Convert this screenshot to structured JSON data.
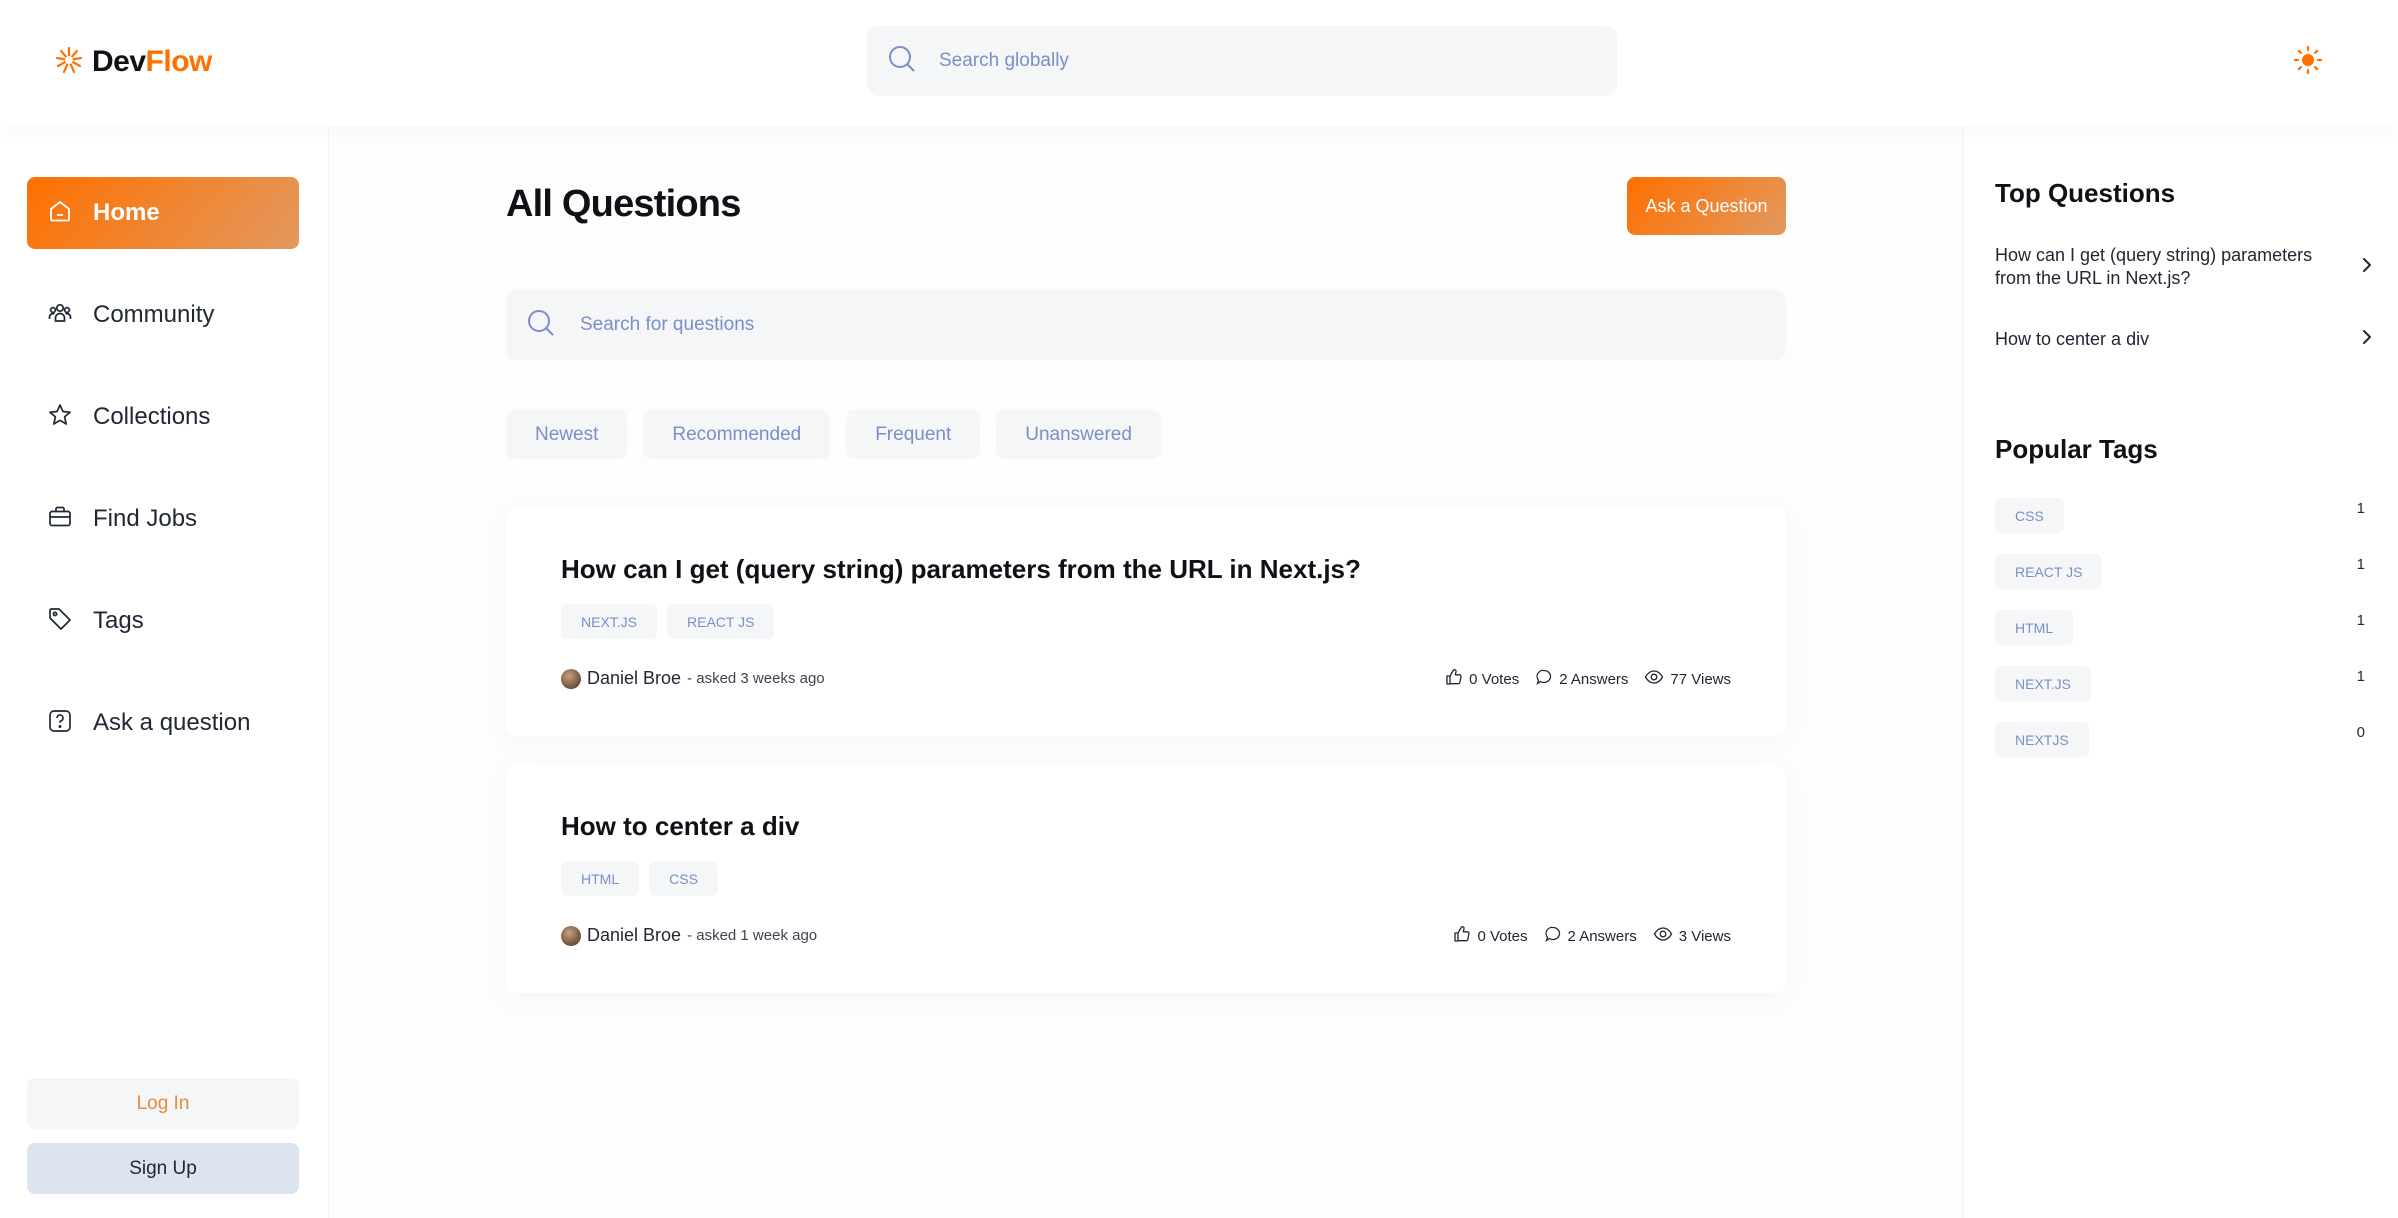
{
  "brand": {
    "name_part1": "Dev",
    "name_part2": "Flow",
    "accent_color": "#ff7000"
  },
  "header": {
    "search_placeholder": "Search globally",
    "theme_icon": "sun-icon"
  },
  "sidebar": {
    "items": [
      {
        "label": "Home",
        "icon": "home-icon",
        "active": true
      },
      {
        "label": "Community",
        "icon": "users-icon",
        "active": false
      },
      {
        "label": "Collections",
        "icon": "star-icon",
        "active": false
      },
      {
        "label": "Find Jobs",
        "icon": "briefcase-icon",
        "active": false
      },
      {
        "label": "Tags",
        "icon": "tag-icon",
        "active": false
      },
      {
        "label": "Ask a question",
        "icon": "question-icon",
        "active": false
      }
    ],
    "login_label": "Log In",
    "signup_label": "Sign Up"
  },
  "main": {
    "title": "All Questions",
    "ask_button_label": "Ask a Question",
    "search_placeholder": "Search for questions",
    "filters": [
      "Newest",
      "Recommended",
      "Frequent",
      "Unanswered"
    ],
    "questions": [
      {
        "title": "How can I get (query string) parameters from the URL in Next.js?",
        "tags": [
          "NEXT.JS",
          "REACT JS"
        ],
        "author": "Daniel Broe",
        "asked": "- asked 3 weeks ago",
        "votes": "0 Votes",
        "answers": "2 Answers",
        "views": "77 Views"
      },
      {
        "title": "How to center a div",
        "tags": [
          "HTML",
          "CSS"
        ],
        "author": "Daniel Broe",
        "asked": "- asked 1 week ago",
        "votes": "0 Votes",
        "answers": "2 Answers",
        "views": "3 Views"
      }
    ]
  },
  "rightbar": {
    "top_questions_title": "Top Questions",
    "top_questions": [
      "How can I get (query string) parameters from the URL in Next.js?",
      "How to center a div"
    ],
    "popular_tags_title": "Popular Tags",
    "popular_tags": [
      {
        "name": "CSS",
        "count": "1"
      },
      {
        "name": "REACT JS",
        "count": "1"
      },
      {
        "name": "HTML",
        "count": "1"
      },
      {
        "name": "NEXT.JS",
        "count": "1"
      },
      {
        "name": "NEXTJS",
        "count": "0"
      }
    ]
  }
}
